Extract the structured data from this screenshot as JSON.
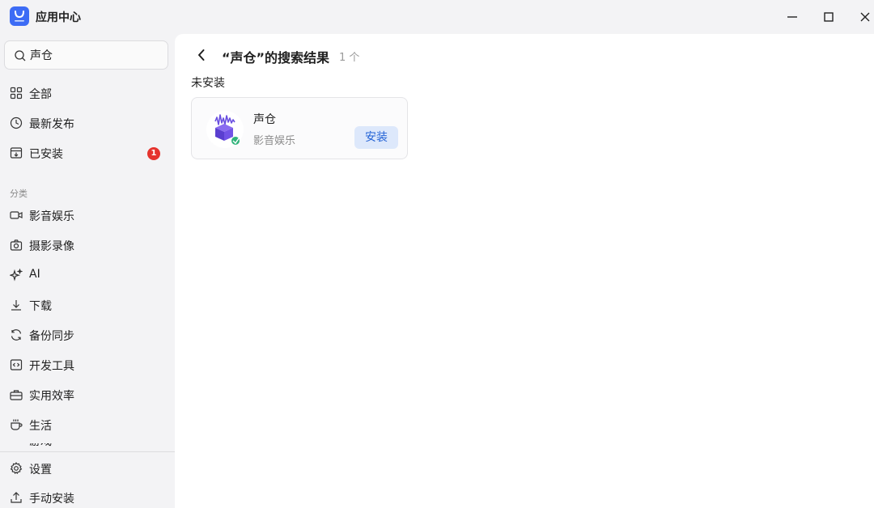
{
  "app": {
    "title": "应用中心"
  },
  "search": {
    "value": "声仓"
  },
  "sidebar": {
    "items": [
      {
        "label": "全部",
        "icon": "grid-icon"
      },
      {
        "label": "最新发布",
        "icon": "clock-icon"
      },
      {
        "label": "已安装",
        "icon": "installed-box-icon",
        "badge": "1"
      }
    ],
    "section_label": "分类",
    "categories": [
      {
        "label": "影音娱乐",
        "icon": "video-camera-icon"
      },
      {
        "label": "摄影录像",
        "icon": "camera-icon"
      },
      {
        "label": "AI",
        "icon": "sparkle-icon"
      },
      {
        "label": "下载",
        "icon": "download-icon"
      },
      {
        "label": "备份同步",
        "icon": "sync-icon"
      },
      {
        "label": "开发工具",
        "icon": "code-icon"
      },
      {
        "label": "实用效率",
        "icon": "toolbox-icon"
      },
      {
        "label": "生活",
        "icon": "cup-icon"
      }
    ],
    "cut_item": "游戏",
    "bottom": [
      {
        "label": "设置",
        "icon": "gear-icon"
      },
      {
        "label": "手动安装",
        "icon": "upload-icon"
      }
    ]
  },
  "main": {
    "title": "“声仓”的搜索结果",
    "count": "1 个",
    "group_label": "未安装",
    "results": [
      {
        "name": "声仓",
        "category": "影音娱乐",
        "action": "安装"
      }
    ]
  },
  "colors": {
    "accent": "#2463d6",
    "badge": "#e5332d",
    "logo": "#3d6cf5"
  }
}
